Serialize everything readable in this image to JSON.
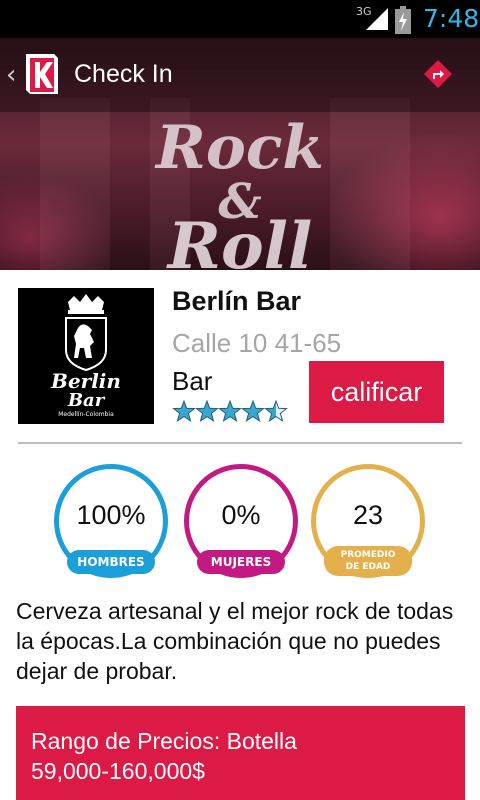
{
  "status_bar": {
    "network": "3G",
    "time": "7:48"
  },
  "action_bar": {
    "title": "Check In",
    "app_icon": "k-logo-icon",
    "back_icon": "chevron-left-icon",
    "action_icon": "directions-icon"
  },
  "hero": {
    "text_line1": "Rock",
    "text_line2": "&",
    "text_line3": "Roll"
  },
  "venue": {
    "name": "Berlín Bar",
    "address": "Calle 10 41-65",
    "type": "Bar",
    "rating": 4.5,
    "rating_max": 5,
    "logo": {
      "line1": "Berlin",
      "line2": "Bar",
      "line3": "Medellín-Colombia"
    },
    "rate_button": "calificar"
  },
  "stats": [
    {
      "value": "100%",
      "label": "HOMBRES",
      "color": "#1a9fd9"
    },
    {
      "value": "0%",
      "label": "MUJERES",
      "color": "#c21a82"
    },
    {
      "value": "23",
      "label_line1": "PROMEDIO",
      "label_line2": "DE EDAD",
      "color": "#e3b04b"
    }
  ],
  "description": "Cerveza artesanal y el mejor rock de todas la épocas.La combinación que no puedes dejar de probar.",
  "price": {
    "line1": "Rango de Precios: Botella",
    "line2": "59,000-160,000$"
  },
  "colors": {
    "accent": "#dc1a46",
    "status_time": "#33b5e5"
  }
}
